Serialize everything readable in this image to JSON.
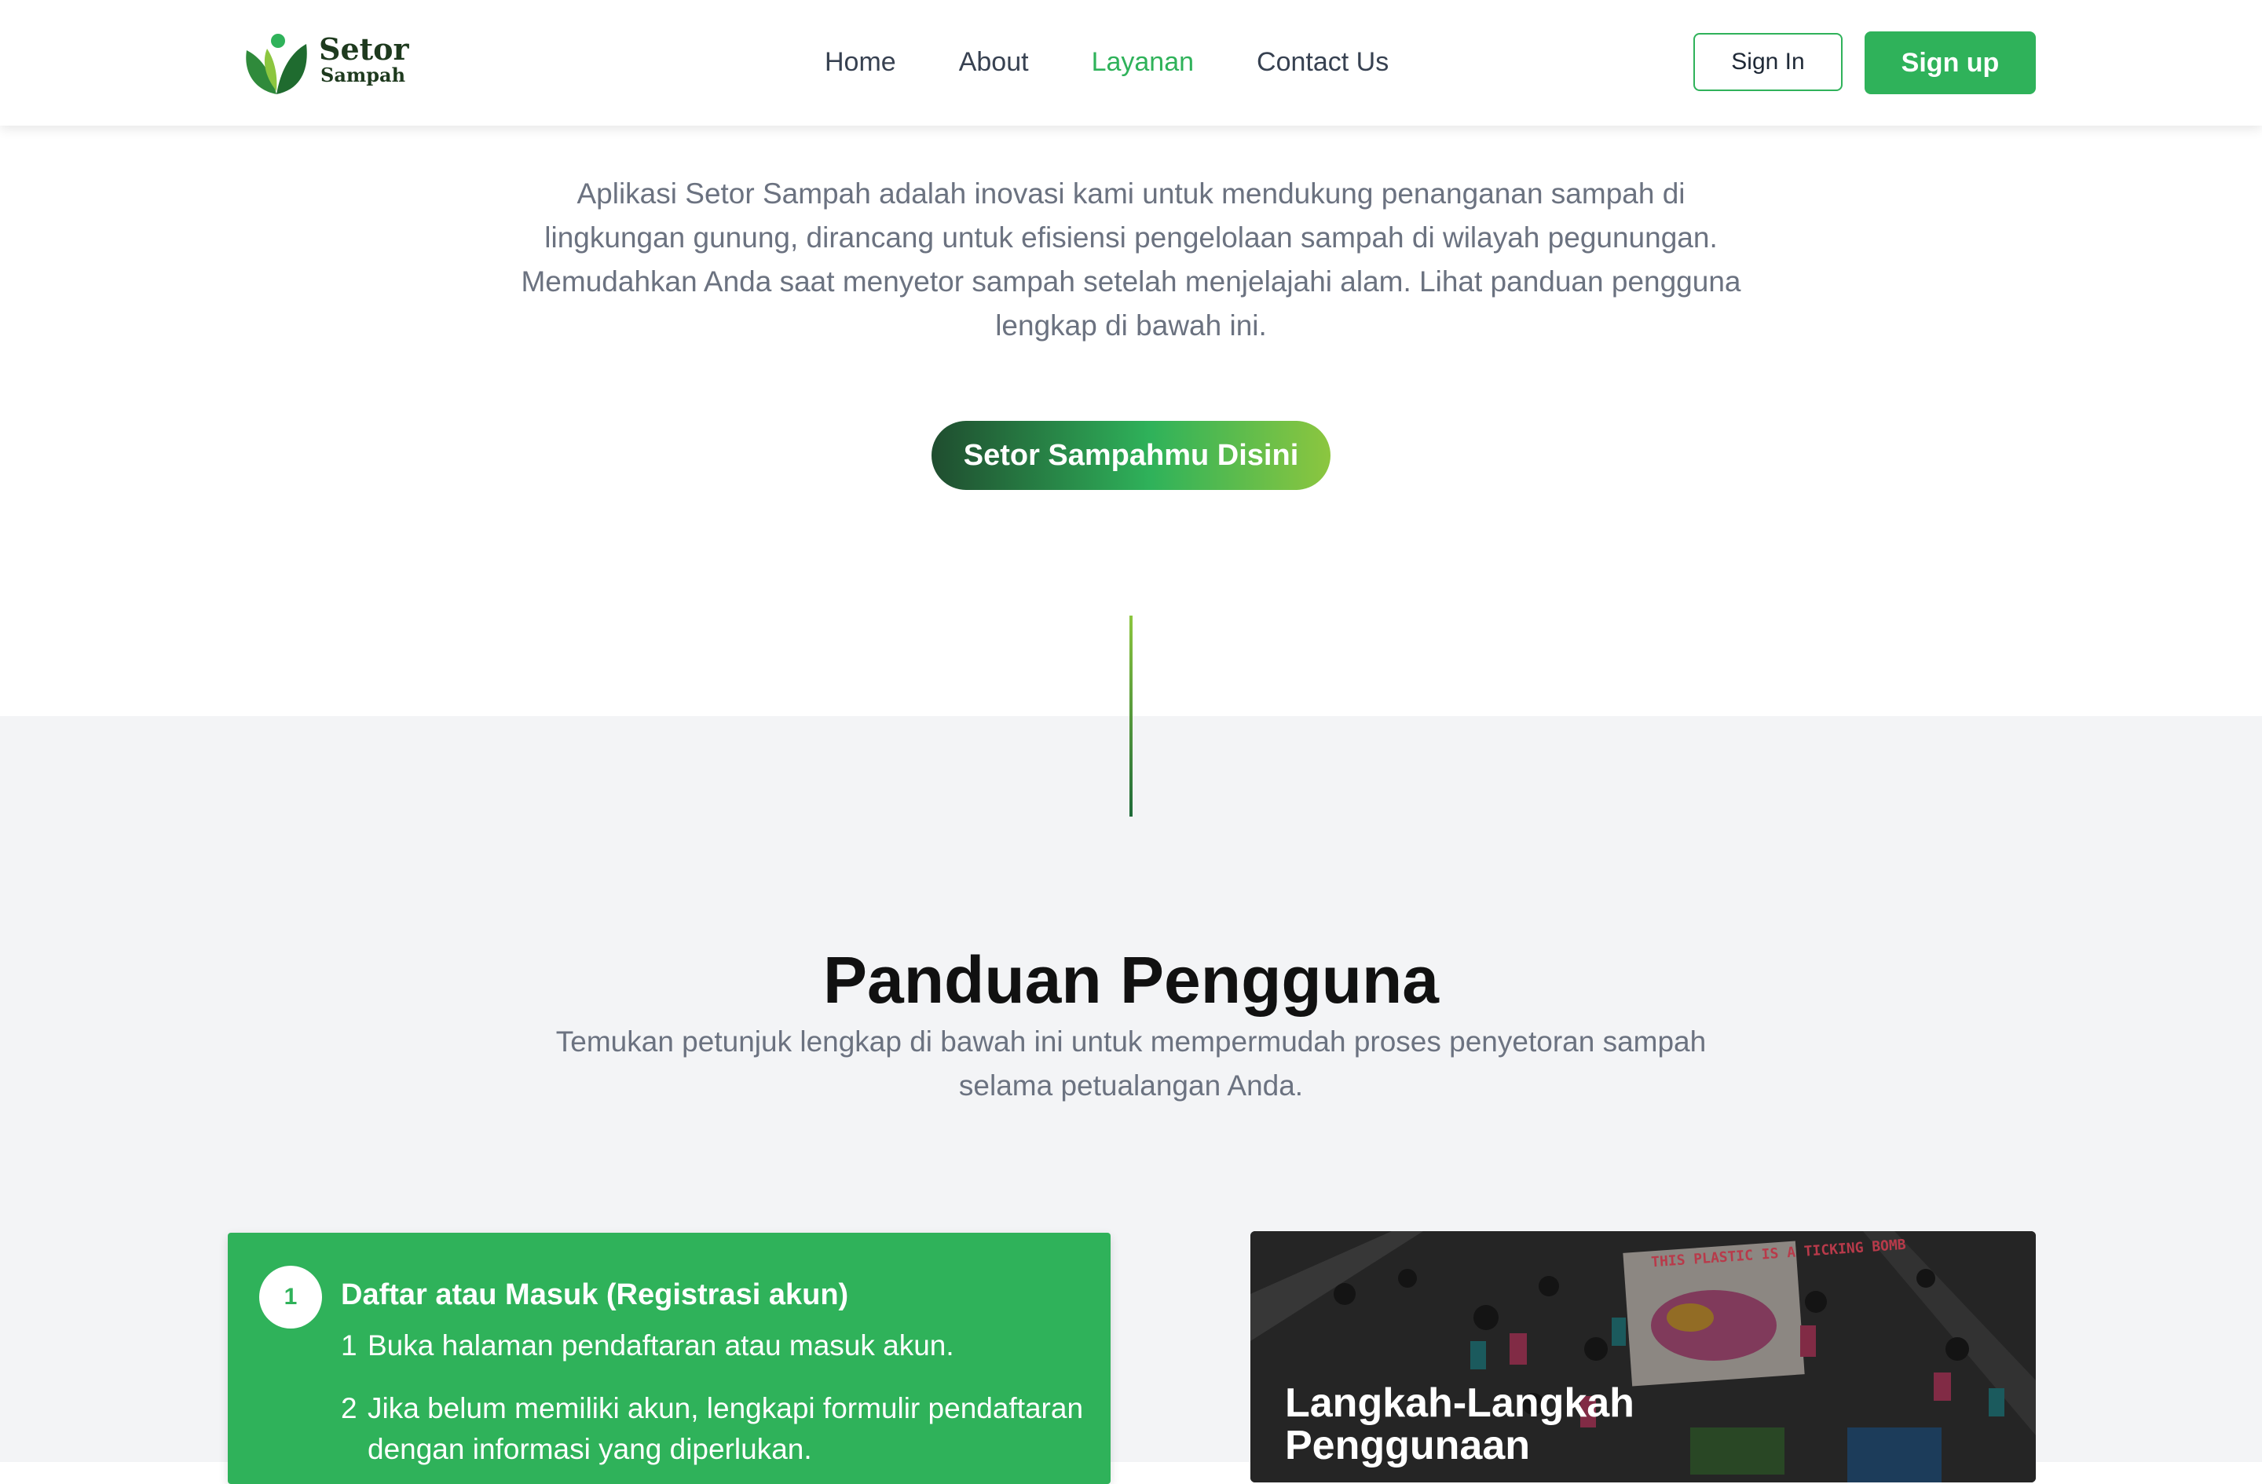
{
  "header": {
    "logo": {
      "line1": "Setor",
      "line2": "Sampah"
    },
    "nav": [
      {
        "label": "Home"
      },
      {
        "label": "About"
      },
      {
        "label": "Layanan",
        "active": true
      },
      {
        "label": "Contact Us"
      }
    ],
    "sign_in": "Sign In",
    "sign_up": "Sign up"
  },
  "hero": {
    "description": "Aplikasi Setor Sampah adalah inovasi kami untuk mendukung penanganan sampah di lingkungan gunung, dirancang untuk efisiensi pengelolaan sampah di wilayah pegunungan. Memudahkan Anda saat menyetor sampah setelah menjelajahi alam. Lihat panduan pengguna lengkap di bawah ini.",
    "cta_label": "Setor Sampahmu Disini"
  },
  "guide": {
    "title": "Panduan Pengguna",
    "description": "Temukan petunjuk lengkap di bawah ini untuk mempermudah proses penyetoran sampah selama petualangan Anda.",
    "step": {
      "number": "1",
      "title": "Daftar atau Masuk (Registrasi akun)",
      "items": [
        {
          "idx": "1",
          "text": "Buka halaman pendaftaran atau masuk akun."
        },
        {
          "idx": "2",
          "text": "Jika belum memiliki akun, lengkapi formulir pendaftaran dengan informasi yang diperlukan."
        }
      ]
    },
    "image_card": {
      "title": "Langkah-Langkah Penggunaan",
      "banner_text": "THIS PLASTIC IS A TICKING BOMB"
    }
  },
  "colors": {
    "brand_green": "#2fb25a",
    "dark_green": "#1f4d2f",
    "lime": "#8cc63f",
    "muted_text": "#6b7280",
    "section_bg": "#f3f4f6"
  }
}
